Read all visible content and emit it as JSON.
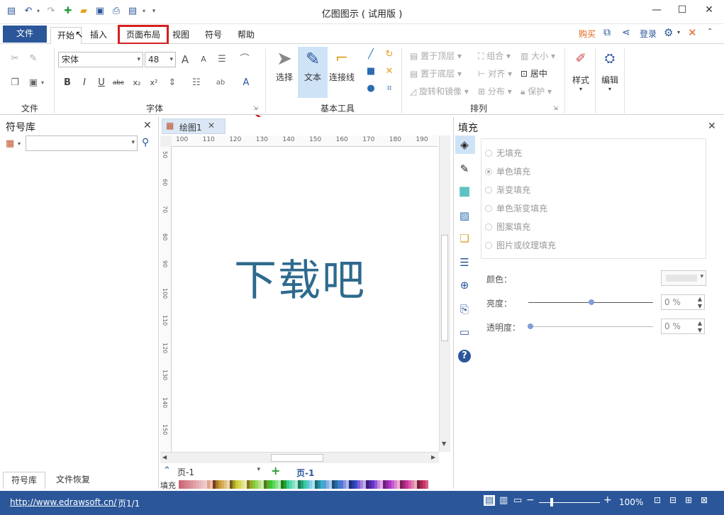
{
  "window": {
    "title": "亿图图示 ( 试用版 )",
    "min": "—",
    "max": "☐",
    "close": "✕"
  },
  "menu": {
    "file": "文件",
    "home": "开始",
    "insert": "插入",
    "page_layout": "页面布局",
    "view": "视图",
    "symbols": "符号",
    "help": "帮助",
    "buy": "购买",
    "login": "登录"
  },
  "ribbon": {
    "groups": {
      "file": "文件",
      "font": "字体",
      "basic_tools": "基本工具",
      "arrange": "排列"
    },
    "font_name": "宋体",
    "font_size": "48",
    "tools": {
      "select": "选择",
      "text": "文本",
      "connector": "连接线"
    },
    "arrange": {
      "bring_front": "置于顶层",
      "send_back": "置于底层",
      "rotate": "旋转和镜像",
      "group": "组合",
      "align": "对齐",
      "distribute": "分布",
      "size": "大小",
      "center": "居中",
      "protect": "保护"
    },
    "style": "样式",
    "edit": "编辑"
  },
  "left_panel": {
    "title": "符号库",
    "tabs": [
      "符号库",
      "文件恢复"
    ]
  },
  "canvas": {
    "tab_name": "绘图1",
    "text": "下载吧",
    "ruler_h": [
      "100",
      "110",
      "120",
      "130",
      "140",
      "150",
      "160",
      "170",
      "180",
      "190"
    ],
    "ruler_v": [
      "50",
      "60",
      "70",
      "80",
      "90",
      "100",
      "110",
      "120",
      "130",
      "140",
      "150"
    ],
    "page_select": "页-1",
    "page_tab": "页-1",
    "fill_label": "填充"
  },
  "right_panel": {
    "title": "填充",
    "options": [
      "无填充",
      "单色填充",
      "渐变填充",
      "单色渐变填充",
      "图案填充",
      "图片或纹理填充"
    ],
    "color_label": "颜色：",
    "brightness_label": "亮度：",
    "brightness_value": "0 %",
    "transparency_label": "透明度：",
    "transparency_value": "0 %"
  },
  "status": {
    "url": "http://www.edrawsoft.cn/",
    "page": "页1/1",
    "zoom": "100%"
  },
  "colors": {
    "accent": "#2b579a",
    "highlight": "#d42020",
    "canvas_text": "#2e6a8e"
  }
}
